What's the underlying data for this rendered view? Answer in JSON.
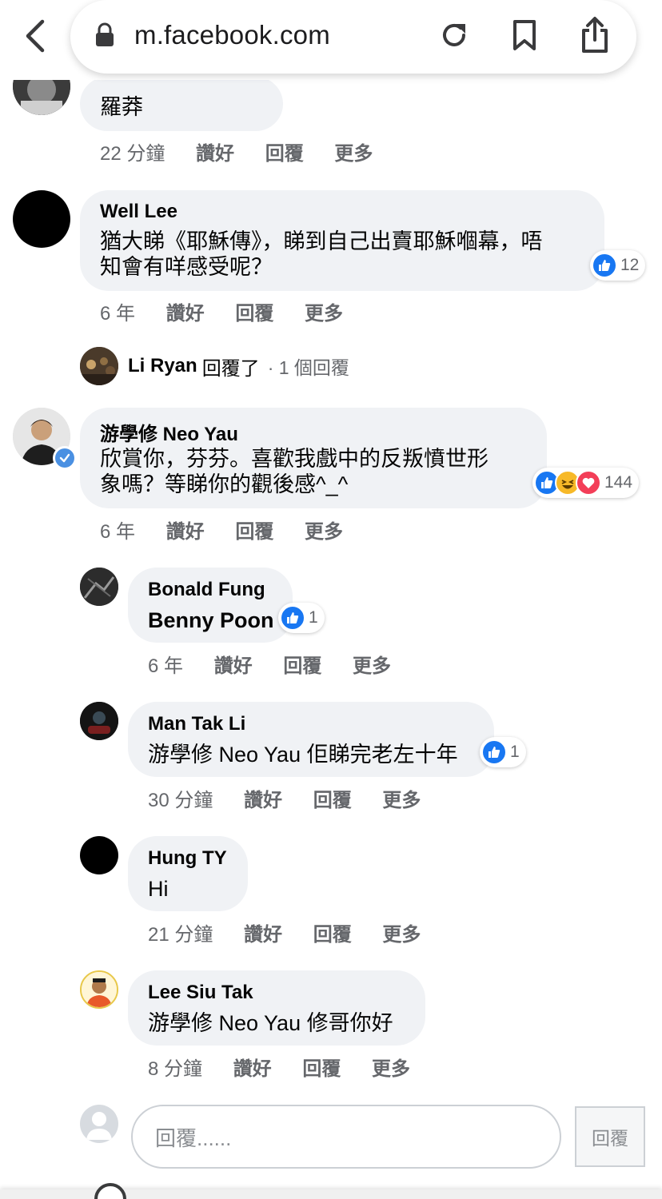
{
  "browser": {
    "url": "m.facebook.com"
  },
  "comments": [
    {
      "author": "",
      "text_lines": [
        "羅莽"
      ],
      "time": "22 分鐘",
      "like": "讚好",
      "reply": "回覆",
      "more": "更多"
    },
    {
      "author": "Well Lee",
      "text_lines": [
        "猶大睇《耶穌傳》，睇到自己出賣耶穌嗰幕，唔",
        "知會有咩感受呢？"
      ],
      "reaction_count": "12",
      "time": "6 年",
      "like": "讚好",
      "reply": "回覆",
      "more": "更多",
      "replies_summary": {
        "name": "Li Ryan",
        "text": "回覆了",
        "count": "· 1 個回覆"
      }
    },
    {
      "author": "游學修 Neo Yau",
      "text_lines": [
        "欣賞你，芬芬。喜歡我戲中的反叛憤世形",
        "象嗎？等睇你的觀後感^_^"
      ],
      "reaction_count": "144",
      "time": "6 年",
      "like": "讚好",
      "reply": "回覆",
      "more": "更多"
    },
    {
      "author": "Bonald Fung",
      "text_lines": [
        "Benny Poon"
      ],
      "reaction_count": "1",
      "time": "6 年",
      "like": "讚好",
      "reply": "回覆",
      "more": "更多"
    },
    {
      "author": "Man Tak Li",
      "text_lines": [
        "游學修 Neo Yau 佢睇完老左十年"
      ],
      "reaction_count": "1",
      "time": "30 分鐘",
      "like": "讚好",
      "reply": "回覆",
      "more": "更多"
    },
    {
      "author": "Hung TY",
      "text_lines": [
        "Hi"
      ],
      "time": "21 分鐘",
      "like": "讚好",
      "reply": "回覆",
      "more": "更多"
    },
    {
      "author": "Lee Siu Tak",
      "text_lines": [
        "游學修 Neo Yau 修哥你好"
      ],
      "time": "8 分鐘",
      "like": "讚好",
      "reply": "回覆",
      "more": "更多"
    }
  ],
  "composer": {
    "placeholder": "回覆......",
    "button": "回覆"
  },
  "colors": {
    "like_blue": "#1877f2",
    "bubble_bg": "#f0f2f5",
    "meta_gray": "#65676b",
    "verified_blue": "#1877f2"
  }
}
